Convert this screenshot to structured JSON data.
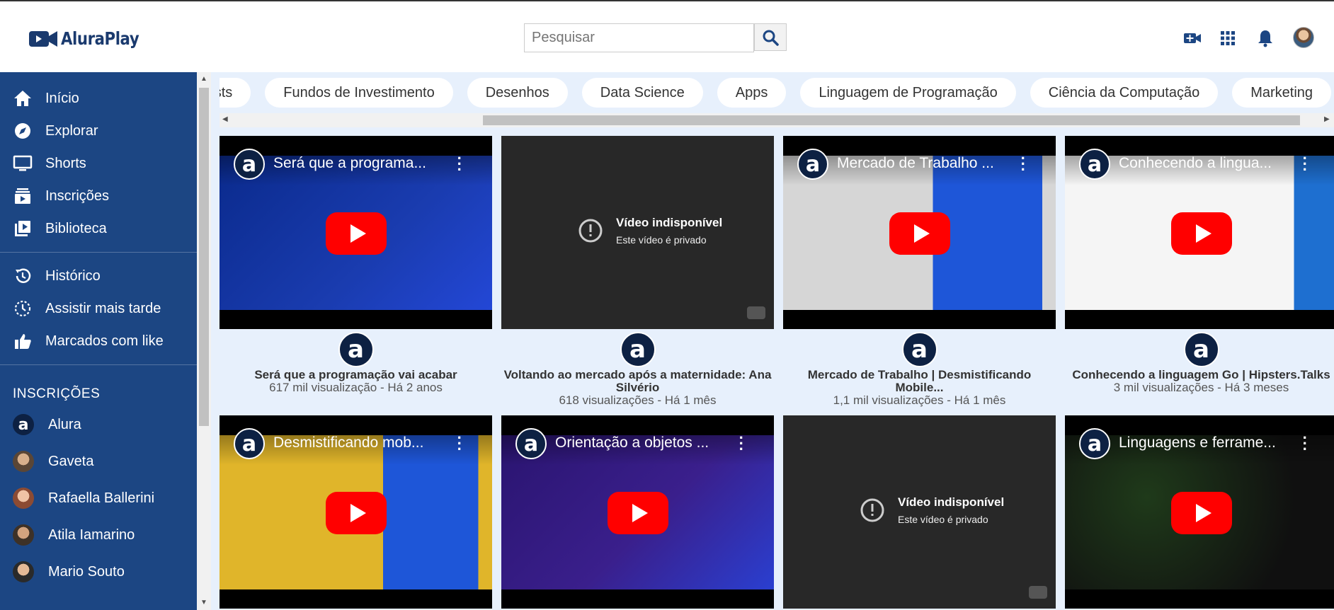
{
  "header": {
    "logo_text": "AluraPlay",
    "search_placeholder": "Pesquisar"
  },
  "sidebar": {
    "main_items": [
      {
        "label": "Início",
        "icon": "home-icon"
      },
      {
        "label": "Explorar",
        "icon": "compass-icon"
      },
      {
        "label": "Shorts",
        "icon": "shorts-icon"
      },
      {
        "label": "Inscrições",
        "icon": "subscriptions-icon"
      },
      {
        "label": "Biblioteca",
        "icon": "library-icon"
      }
    ],
    "secondary_items": [
      {
        "label": "Histórico",
        "icon": "history-icon"
      },
      {
        "label": "Assistir mais tarde",
        "icon": "clock-icon"
      },
      {
        "label": "Marcados com like",
        "icon": "thumbs-up-icon"
      }
    ],
    "subscriptions_heading": "INSCRIÇÕES",
    "subscriptions": [
      {
        "name": "Alura"
      },
      {
        "name": "Gaveta"
      },
      {
        "name": "Rafaella Ballerini"
      },
      {
        "name": "Atila Iamarino"
      },
      {
        "name": "Mario Souto"
      }
    ]
  },
  "chips": [
    "Podcasts",
    "Fundos de Investimento",
    "Desenhos",
    "Data Science",
    "Apps",
    "Linguagem de Programação",
    "Ciência da Computação",
    "Marketing"
  ],
  "videos": [
    {
      "overlay_title": "Será que a programa...",
      "title": "Será que a programação vai acabar",
      "info": "617 mil visualização - Há 2 anos",
      "available": true,
      "thumb_bg": "#1a3cb0"
    },
    {
      "overlay_title": "",
      "title": "Voltando ao mercado após a maternidade: Ana Silvério",
      "info": "618 visualizações - Há 1 mês",
      "available": false,
      "unavailable_title": "Vídeo indisponível",
      "unavailable_sub": "Este vídeo é privado"
    },
    {
      "overlay_title": "Mercado de Trabalho ...",
      "title": "Mercado de Trabalho | Desmistificando Mobile...",
      "info": "1,1 mil visualizações - Há 1 mês",
      "available": true,
      "thumb_bg": "#d9d9d9"
    },
    {
      "overlay_title": "Conhecendo a lingua...",
      "title": "Conhecendo a linguagem Go | Hipsters.Talks",
      "info": "3 mil visualizações - Há 3 meses",
      "available": true,
      "thumb_bg": "#f4f4f4"
    },
    {
      "overlay_title": "Desmistificando mob...",
      "title": "",
      "info": "",
      "available": true,
      "thumb_bg": "#e0b52a"
    },
    {
      "overlay_title": "Orientação a objetos ...",
      "title": "",
      "info": "",
      "available": true,
      "thumb_bg": "#3a1f8c"
    },
    {
      "overlay_title": "",
      "title": "",
      "info": "",
      "available": false,
      "unavailable_title": "Vídeo indisponível",
      "unavailable_sub": "Este vídeo é privado"
    },
    {
      "overlay_title": "Linguagens e ferrame...",
      "title": "",
      "info": "",
      "available": true,
      "thumb_bg": "#101010"
    }
  ]
}
